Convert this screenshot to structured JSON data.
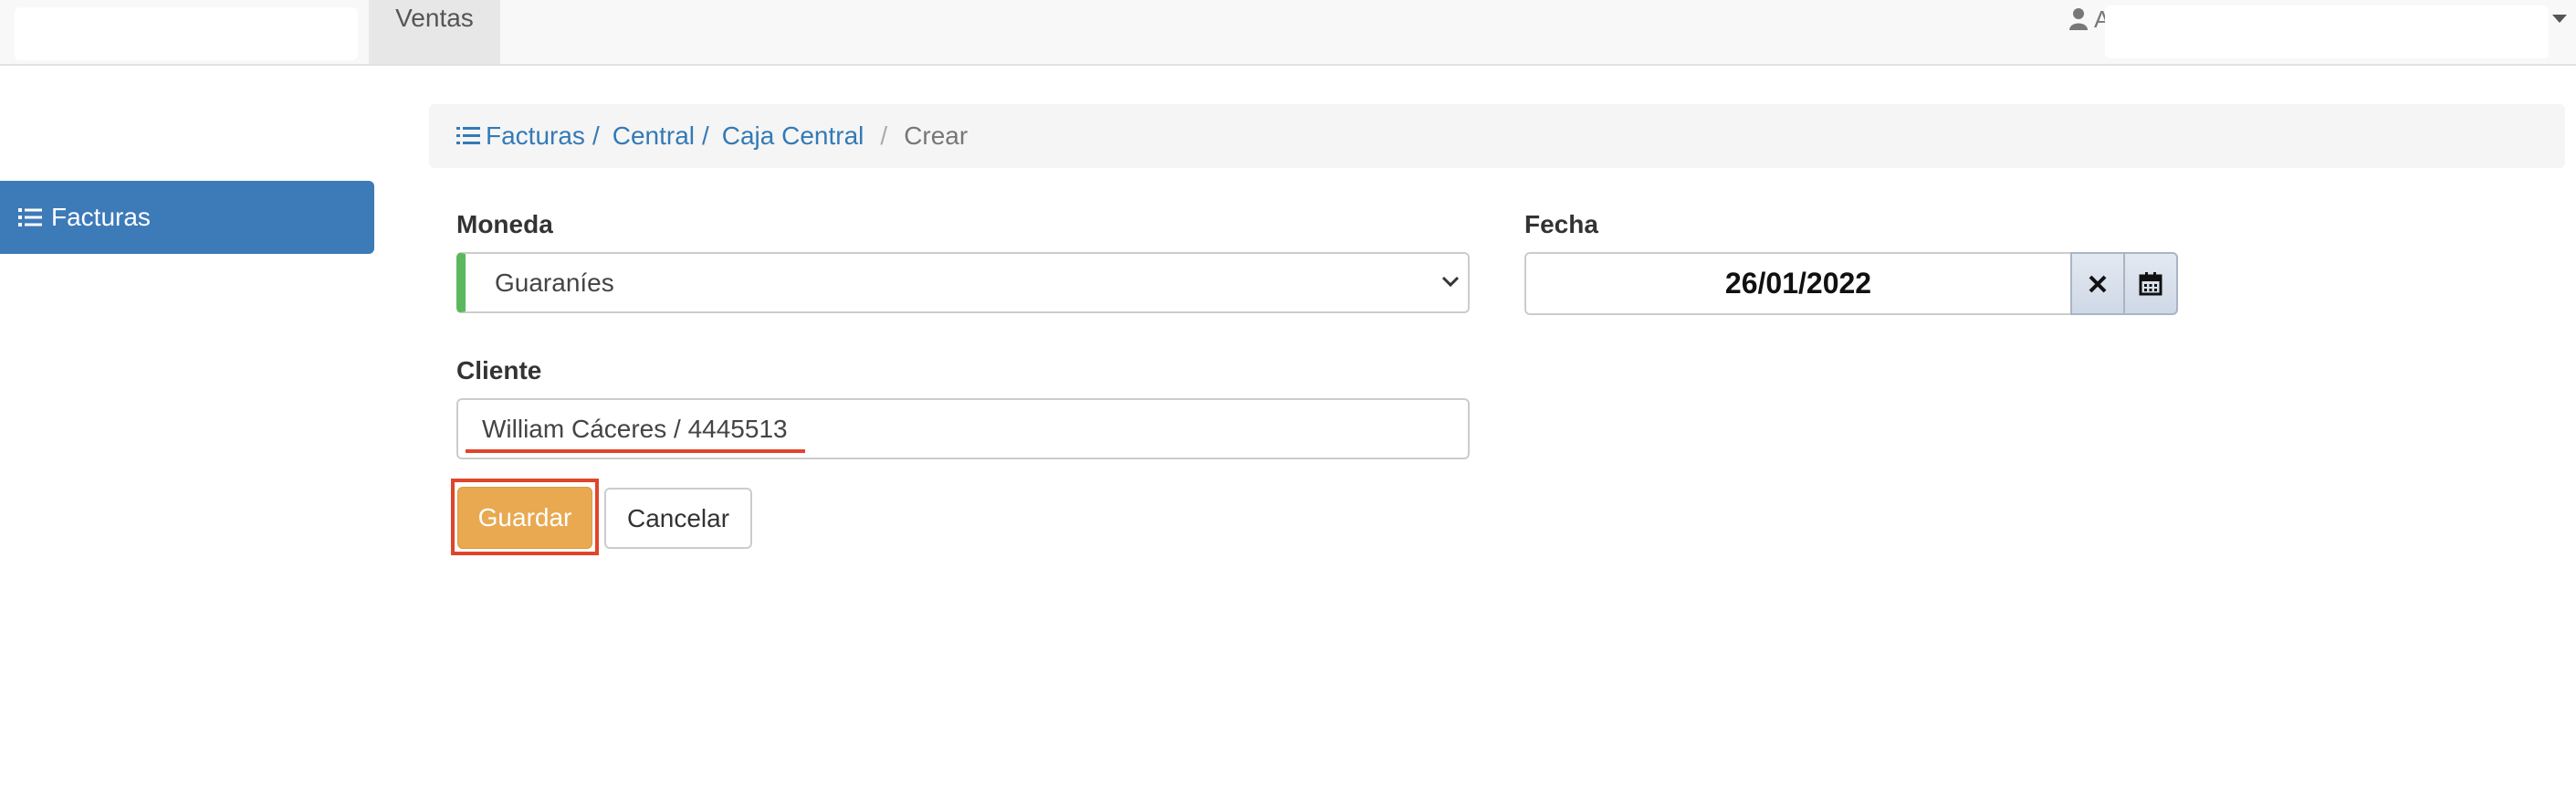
{
  "navbar": {
    "tab_label": "Ventas",
    "user_initial": "A"
  },
  "sidebar": {
    "items": [
      {
        "label": "Facturas",
        "icon": "list-icon"
      }
    ]
  },
  "breadcrumb": {
    "items": [
      "Facturas",
      "Central",
      "Caja Central"
    ],
    "separator": "/",
    "active": "Crear"
  },
  "form": {
    "moneda": {
      "label": "Moneda",
      "value": "Guaraníes"
    },
    "fecha": {
      "label": "Fecha",
      "value": "26/01/2022"
    },
    "cliente": {
      "label": "Cliente",
      "value": "William Cáceres / 4445513"
    }
  },
  "buttons": {
    "save_label": "Guardar",
    "cancel_label": "Cancelar"
  },
  "colors": {
    "primary": "#3d7ab8",
    "link": "#337ab7",
    "save": "#e8a951",
    "valid": "#5cb85c",
    "highlight": "#e0452b"
  }
}
